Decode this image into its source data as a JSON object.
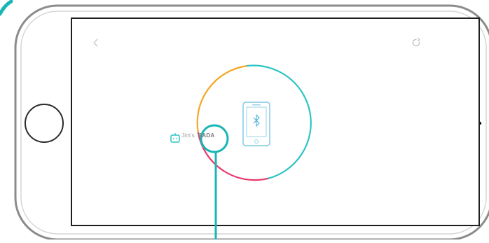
{
  "screen": {
    "back_icon": "chevron-left-icon",
    "refresh_icon": "refresh-icon"
  },
  "pairing": {
    "user_label": "Jim's",
    "device_label": "BADA",
    "robot_icon": "robot-face-icon",
    "phone_icon": "smartphone-bluetooth-icon",
    "bluetooth_icon": "bluetooth-icon"
  },
  "colors": {
    "ring_orange": "#f5a623",
    "ring_teal": "#2ec4c4",
    "ring_pink": "#e8386b",
    "callout_teal": "#19b5b5",
    "phone_blue": "#4ab3d9"
  }
}
